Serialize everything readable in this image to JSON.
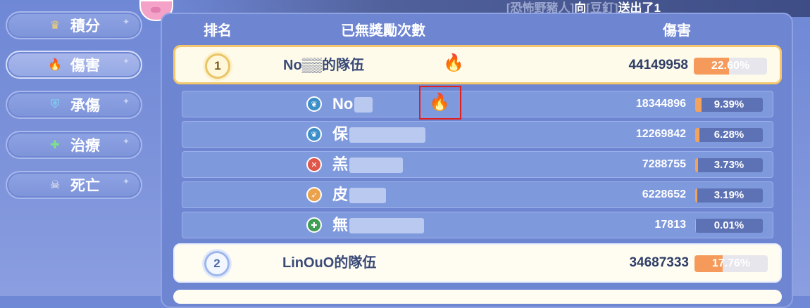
{
  "banner": {
    "sender": "[恐怖野豬人]",
    "connector": "向",
    "receiver": "[豆釘]",
    "action": "送出了1"
  },
  "sidebar": {
    "items": [
      {
        "label": "積分",
        "icon": "crown-icon"
      },
      {
        "label": "傷害",
        "icon": "fire-icon",
        "active": true
      },
      {
        "label": "承傷",
        "icon": "shield-icon"
      },
      {
        "label": "治療",
        "icon": "plus-icon"
      },
      {
        "label": "死亡",
        "icon": "skull-icon"
      }
    ]
  },
  "table": {
    "headers": {
      "rank": "排名",
      "no_reward": "已無獎勵次數",
      "damage": "傷害"
    },
    "teams": [
      {
        "rank": "1",
        "name": "No▒▒的隊伍",
        "damage": "44149958",
        "percent": "22.60%",
        "percent_value": 22.6,
        "members": [
          {
            "name": "No",
            "damage": "18344896",
            "percent": "9.39%",
            "percent_value": 9.39,
            "class_icon": "leaf-icon",
            "class_color": "#3c8fc9"
          },
          {
            "name": "保",
            "damage": "12269842",
            "percent": "6.28%",
            "percent_value": 6.28,
            "class_icon": "leaf-icon",
            "class_color": "#3c8fc9"
          },
          {
            "name": "羔",
            "damage": "7288755",
            "percent": "3.73%",
            "percent_value": 3.73,
            "class_icon": "crossed-swords-icon",
            "class_color": "#e0564a"
          },
          {
            "name": "皮",
            "damage": "6228652",
            "percent": "3.19%",
            "percent_value": 3.19,
            "class_icon": "bow-icon",
            "class_color": "#eaa24c"
          },
          {
            "name": "無",
            "damage": "17813",
            "percent": "0.01%",
            "percent_value": 0.01,
            "class_icon": "cross-icon",
            "class_color": "#3f9d54"
          }
        ]
      },
      {
        "rank": "2",
        "name": "LinOuO的隊伍",
        "damage": "34687333",
        "percent": "17.76%",
        "percent_value": 17.76
      }
    ]
  }
}
